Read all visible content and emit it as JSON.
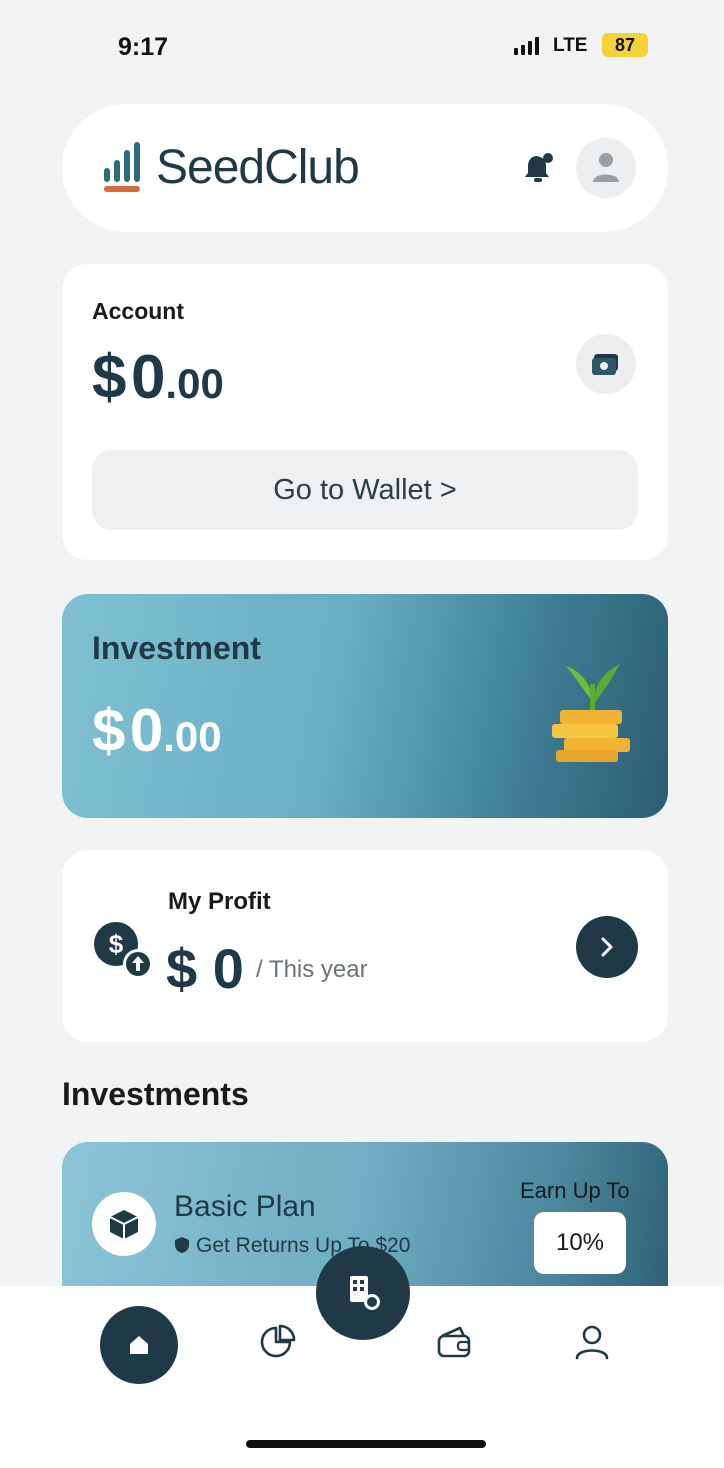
{
  "status_bar": {
    "time": "9:17",
    "network": "LTE",
    "battery": "87"
  },
  "header": {
    "app_name": "SeedClub",
    "icons": [
      "notification-bell-icon",
      "avatar-icon"
    ]
  },
  "account": {
    "label": "Account",
    "currency": "$",
    "amount_main": "0",
    "amount_cents": ".00",
    "wallet_button_label": "Go to Wallet >"
  },
  "investment": {
    "label": "Investment",
    "currency": "$",
    "amount_main": "0",
    "amount_cents": ".00",
    "illustration": "coin-stack-sprout-icon"
  },
  "profit": {
    "label": "My Profit",
    "amount": "$ 0",
    "period": "/ This year"
  },
  "investments_section": {
    "title": "Investments",
    "plans": [
      {
        "name": "Basic Plan",
        "description": "Get Returns Up To $20",
        "earn_label": "Earn Up To",
        "earn_value": "10%"
      }
    ]
  },
  "bottom_nav": {
    "items": [
      "home-icon",
      "portfolio-pie-icon",
      "invest-fab-icon",
      "wallet-icon",
      "profile-icon"
    ],
    "active": "home-icon"
  },
  "colors": {
    "primary": "#1f3a46",
    "background": "#f2f3f5",
    "accent_battery": "#f3d23a"
  }
}
